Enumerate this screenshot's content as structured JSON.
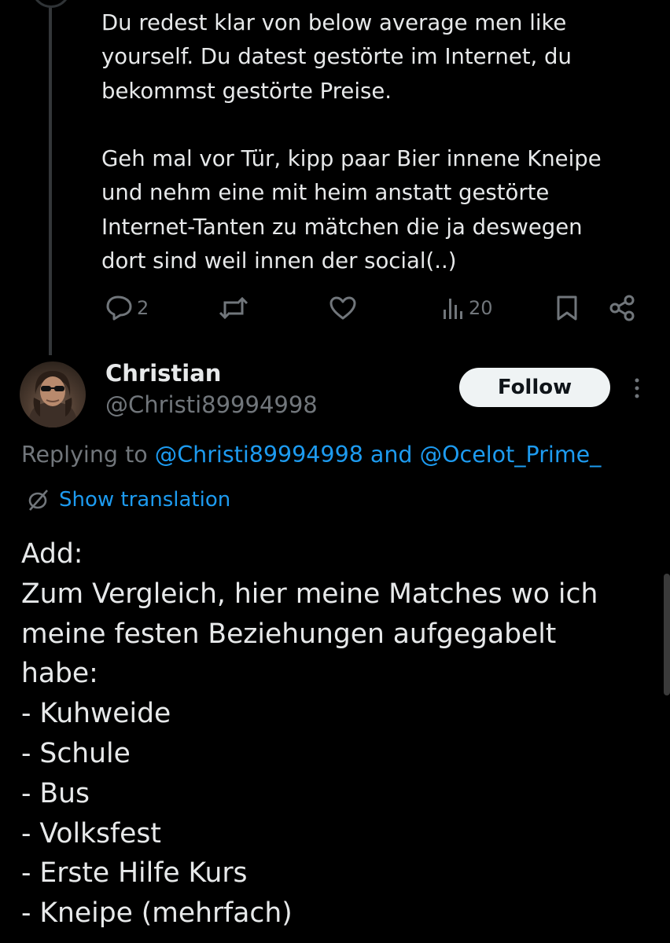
{
  "previous_tweet": {
    "text": "Du redest klar von below average men like\nyourself. Du datest gestörte im Internet, du\nbekommst gestörte Preise.\n\nGeh mal vor Tür, kipp paar Bier innene Kneipe\nund nehm eine mit heim anstatt gestörte\nInternet-Tanten zu mätchen die ja deswegen\ndort sind weil innen der social(..)",
    "actions": {
      "replies": "2",
      "retweets": "",
      "likes": "",
      "views": "20"
    }
  },
  "tweet": {
    "display_name": "Christian",
    "handle": "@Christi89994998",
    "follow_label": "Follow",
    "replying_prefix": "Replying to ",
    "mention_1": "@Christi89994998",
    "mention_joiner": " and ",
    "mention_2": "@Ocelot_Prime_",
    "show_translation_label": "Show translation",
    "text": "Add:\nZum Vergleich, hier meine Matches wo ich\nmeine festen Beziehungen aufgegabelt\nhabe:\n- Kuhweide\n- Schule\n- Bus\n- Volksfest\n- Erste Hilfe Kurs\n- Kneipe (mehrfach)"
  },
  "colors": {
    "background": "#000000",
    "text_primary": "#e7e9ea",
    "text_secondary": "#71767b",
    "accent": "#1d9bf0",
    "follow_button_bg": "#eff3f4"
  },
  "icons": [
    "reply-icon",
    "retweet-icon",
    "like-icon",
    "views-icon",
    "bookmark-icon",
    "share-icon",
    "more-icon",
    "translate-icon"
  ]
}
